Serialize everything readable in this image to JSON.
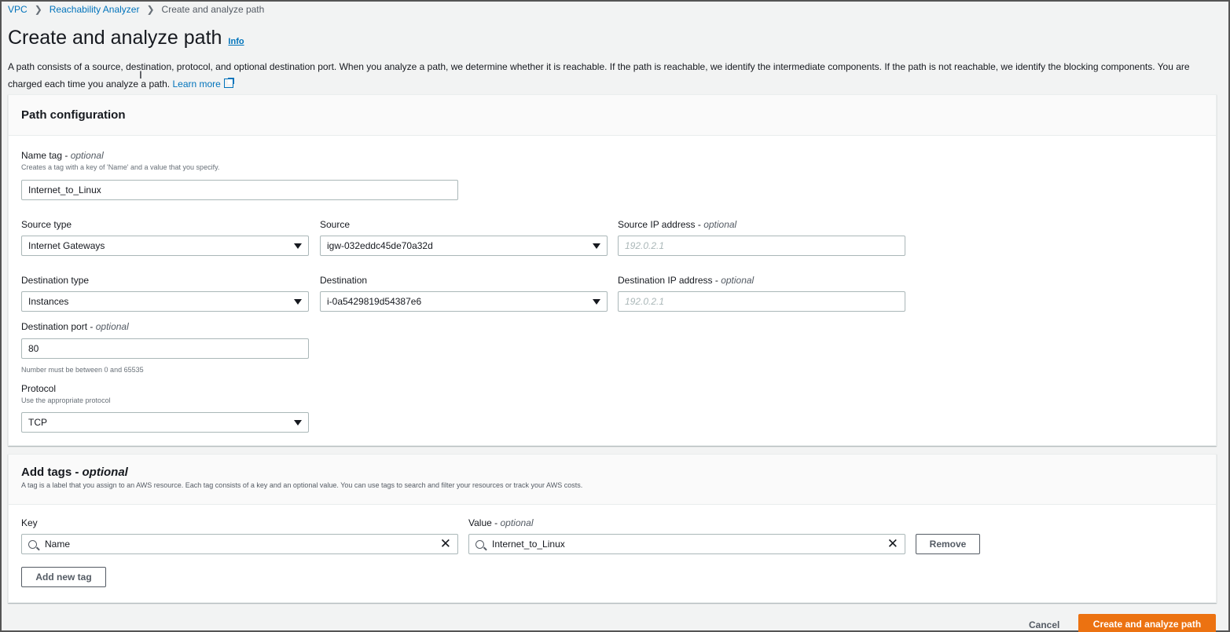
{
  "breadcrumb": {
    "items": [
      "VPC",
      "Reachability Analyzer"
    ],
    "current": "Create and analyze path"
  },
  "header": {
    "title": "Create and analyze path",
    "info": "Info",
    "description": "A path consists of a source, destination, protocol, and optional destination port. When you analyze a path, we determine whether it is reachable. If the path is reachable, we identify the intermediate components. If the path is not reachable, we identify the blocking components. You are charged each time you analyze a path.",
    "learn_more": "Learn more"
  },
  "path_config": {
    "title": "Path configuration",
    "name_tag": {
      "label": "Name tag",
      "optional": "optional",
      "hint": "Creates a tag with a key of 'Name' and a value that you specify.",
      "value": "Internet_to_Linux"
    },
    "source_type": {
      "label": "Source type",
      "value": "Internet Gateways"
    },
    "source": {
      "label": "Source",
      "value": "igw-032eddc45de70a32d"
    },
    "source_ip": {
      "label": "Source IP address",
      "optional": "optional",
      "placeholder": "192.0.2.1"
    },
    "destination_type": {
      "label": "Destination type",
      "value": "Instances"
    },
    "destination": {
      "label": "Destination",
      "value": "i-0a5429819d54387e6"
    },
    "destination_ip": {
      "label": "Destination IP address",
      "optional": "optional",
      "placeholder": "192.0.2.1"
    },
    "destination_port": {
      "label": "Destination port",
      "optional": "optional",
      "value": "80",
      "hint": "Number must be between 0 and 65535"
    },
    "protocol": {
      "label": "Protocol",
      "hint": "Use the appropriate protocol",
      "value": "TCP"
    }
  },
  "tags": {
    "title": "Add tags",
    "optional": "optional",
    "description": "A tag is a label that you assign to an AWS resource. Each tag consists of a key and an optional value. You can use tags to search and filter your resources or track your AWS costs.",
    "key_label": "Key",
    "value_label": "Value",
    "value_optional": "optional",
    "key": "Name",
    "value": "Internet_to_Linux",
    "remove_label": "Remove",
    "add_label": "Add new tag"
  },
  "footer": {
    "cancel_label": "Cancel",
    "submit_label": "Create and analyze path"
  },
  "colors": {
    "link": "#0073bb",
    "primary": "#ec7211",
    "background": "#f2f3f3"
  }
}
